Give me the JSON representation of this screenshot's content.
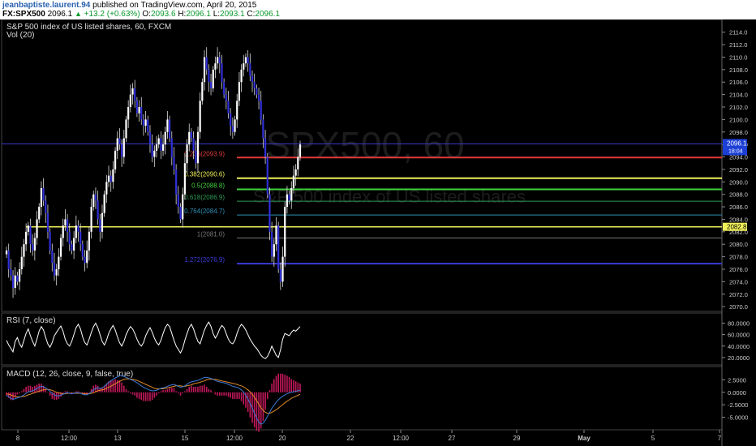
{
  "header": {
    "author": "jeanbaptiste.laurent.94",
    "published": "published on TradingView.com, April 20, 2015",
    "symbol": "FX:SPX500",
    "last": "2096.1",
    "change": "+13.2 (+0.63%)",
    "open_label": "O:",
    "open": "2093.6",
    "high_label": "H:",
    "high": "2096.1",
    "low_label": "L:",
    "low": "2093.1",
    "close_label": "C:",
    "close": "2096.1"
  },
  "legend": {
    "title": "S&P 500 index of US listed shares, 60, FXCM",
    "volume": "Vol (20)",
    "rsi": "RSI (7, close)",
    "macd": "MACD (12, 26, close, 9, false, true)"
  },
  "watermark": {
    "line1": "SPX500, 60",
    "line2": "S&P 500 index of US listed shares"
  },
  "colors": {
    "background": "#000000",
    "candle_up": "#ffffff",
    "candle_down": "#3030d8",
    "fib_0236": "#e23b3b",
    "fib_0382": "#f0f05a",
    "fib_05": "#3fd13f",
    "fib_0618": "#2e9a55",
    "fib_0764": "#2f8fb5",
    "fib_1": "#777777",
    "fib_1272": "#3b3bd6",
    "support_line": "#f0f05a",
    "rsi_line": "#ffffff",
    "macd_line": "#3b7bd8",
    "signal_line": "#e08a2a",
    "hist": "#c2185b"
  },
  "chart_data": [
    {
      "type": "candlestick",
      "title": "S&P 500 index of US listed shares, 60, FXCM",
      "x_ticks": [
        "8",
        "12:00",
        "13",
        "15",
        "12:00",
        "20",
        "22",
        "12:00",
        "27",
        "29",
        "May",
        "5",
        "7"
      ],
      "y_ticks": [
        "2114.0",
        "2112.0",
        "2110.0",
        "2108.0",
        "2106.0",
        "2104.0",
        "2102.0",
        "2100.0",
        "2098.0",
        "2096.0",
        "2094.0",
        "2092.0",
        "2090.0",
        "2088.0",
        "2086.0",
        "2084.0",
        "2082.0",
        "2080.0",
        "2078.0",
        "2076.0",
        "2074.0",
        "2072.0",
        "2070.0"
      ],
      "ylim": [
        2069.5,
        2115.0
      ],
      "close_path": [
        2079,
        2076,
        2075,
        2073,
        2075,
        2074,
        2076,
        2078,
        2080,
        2082,
        2083,
        2080,
        2079,
        2081,
        2084,
        2086,
        2089,
        2087,
        2085,
        2082,
        2079,
        2077,
        2075,
        2076,
        2078,
        2081,
        2083,
        2084,
        2082,
        2080,
        2079,
        2081,
        2083,
        2082,
        2080,
        2078,
        2077,
        2079,
        2082,
        2086,
        2088,
        2087,
        2084,
        2082,
        2085,
        2088,
        2090,
        2091,
        2090,
        2092,
        2095,
        2097,
        2096,
        2094,
        2097,
        2100,
        2102,
        2104,
        2105,
        2103,
        2101,
        2102,
        2100,
        2099,
        2100,
        2098,
        2096,
        2094,
        2095,
        2096,
        2097,
        2095,
        2096,
        2098,
        2100,
        2097,
        2094,
        2092,
        2088,
        2086,
        2084,
        2088,
        2093,
        2096,
        2098,
        2097,
        2095,
        2093,
        2098,
        2103,
        2106,
        2110,
        2108,
        2106,
        2105,
        2108,
        2109,
        2110,
        2109,
        2106,
        2104,
        2103,
        2101,
        2099,
        2098,
        2100,
        2103,
        2106,
        2108,
        2109,
        2110,
        2109,
        2107,
        2106,
        2105,
        2104,
        2103,
        2100,
        2097,
        2094,
        2088,
        2082,
        2078,
        2080,
        2083,
        2076,
        2074,
        2078,
        2086,
        2088,
        2087,
        2089,
        2091,
        2092,
        2094,
        2096
      ],
      "price_label": "2096.1",
      "countdown_label": "18:04",
      "support_label": "2082.8",
      "support_value": 2082.8,
      "fib_levels": [
        {
          "label": "0.236(2093.9)",
          "value": 2093.9,
          "color": "#e23b3b"
        },
        {
          "label": "0.382(2090.6)",
          "value": 2090.6,
          "color": "#f0f05a"
        },
        {
          "label": "0.5(2088.8)",
          "value": 2088.8,
          "color": "#3fd13f"
        },
        {
          "label": "0.618(2086.9)",
          "value": 2086.9,
          "color": "#2e9a55"
        },
        {
          "label": "0.764(2084.7)",
          "value": 2084.7,
          "color": "#2f8fb5"
        },
        {
          "label": "1(2081.0)",
          "value": 2081.0,
          "color": "#777777"
        },
        {
          "label": "1.272(2076.9)",
          "value": 2076.9,
          "color": "#3b3bd6"
        }
      ]
    },
    {
      "type": "line",
      "title": "RSI (7, close)",
      "y_ticks": [
        "80.0000",
        "60.0000",
        "40.0000",
        "20.0000"
      ],
      "ylim": [
        10,
        92
      ],
      "values": [
        50,
        42,
        36,
        30,
        48,
        55,
        44,
        38,
        50,
        62,
        70,
        58,
        48,
        40,
        52,
        66,
        74,
        68,
        55,
        44,
        38,
        46,
        58,
        64,
        70,
        75,
        66,
        52,
        44,
        40,
        48,
        60,
        72,
        78,
        70,
        56,
        46,
        42,
        52,
        64,
        74,
        80,
        72,
        60,
        48,
        42,
        50,
        62,
        70,
        76,
        68,
        56,
        46,
        40,
        48,
        60,
        68,
        74,
        70,
        62,
        52,
        44,
        40,
        46,
        58,
        66,
        72,
        64,
        54,
        46,
        42,
        50,
        62,
        72,
        78,
        74,
        62,
        50,
        40,
        34,
        28,
        36,
        50,
        62,
        72,
        78,
        70,
        58,
        48,
        44,
        56,
        68,
        76,
        82,
        74,
        62,
        54,
        60,
        70,
        76,
        72,
        62,
        52,
        46,
        44,
        50,
        62,
        72,
        78,
        74,
        68,
        60,
        52,
        46,
        40,
        36,
        30,
        24,
        20,
        18,
        22,
        30,
        40,
        32,
        24,
        20,
        34,
        52,
        62,
        60,
        58,
        64,
        68,
        66,
        70,
        74
      ]
    },
    {
      "type": "line",
      "title": "MACD (12, 26, close, 9, false, true)",
      "y_ticks": [
        "2.5000",
        "0.0000",
        "-2.5000",
        "-5.0000"
      ],
      "ylim": [
        -7.2,
        4.2
      ],
      "series": [
        {
          "values": [
            -0.6,
            -0.9,
            -1.2,
            -1.4,
            -1.3,
            -1.1,
            -1.0,
            -0.8,
            -0.5,
            -0.2,
            0.1,
            0.2,
            0.3,
            0.5,
            0.8,
            1.0,
            1.2,
            1.1,
            0.9,
            0.6,
            0.2,
            -0.2,
            -0.5,
            -0.7,
            -0.7,
            -0.6,
            -0.4,
            -0.2,
            -0.1,
            -0.2,
            -0.3,
            -0.2,
            -0.1,
            -0.1,
            -0.2,
            -0.4,
            -0.5,
            -0.5,
            -0.3,
            0.1,
            0.5,
            0.8,
            0.9,
            0.8,
            0.9,
            1.2,
            1.6,
            2.0,
            2.3,
            2.6,
            2.9,
            3.1,
            3.3,
            3.3,
            3.2,
            3.0,
            2.8,
            2.6,
            2.4,
            2.2,
            1.9,
            1.6,
            1.3,
            1.0,
            0.8,
            0.6,
            0.4,
            0.3,
            0.3,
            0.4,
            0.6,
            0.8,
            0.9,
            1.0,
            1.2,
            1.4,
            1.5,
            1.6,
            1.4,
            1.2,
            1.0,
            1.1,
            1.3,
            1.6,
            1.9,
            2.1,
            2.2,
            2.3,
            2.4,
            2.6,
            2.8,
            3.0,
            3.0,
            2.9,
            2.8,
            2.6,
            2.4,
            2.2,
            2.1,
            2.0,
            1.9,
            1.8,
            1.6,
            1.4,
            1.2,
            1.1,
            1.0,
            0.8,
            0.5,
            0.0,
            -0.6,
            -1.3,
            -2.2,
            -3.2,
            -4.2,
            -5.2,
            -6.0,
            -6.4,
            -6.2,
            -5.6,
            -4.8,
            -4.0,
            -3.2,
            -2.6,
            -2.0,
            -1.5,
            -1.1,
            -0.8,
            -0.5,
            -0.3,
            -0.1,
            0.0,
            0.1,
            0.2,
            0.3,
            0.4
          ]
        },
        {
          "values": [
            -0.3,
            -0.4,
            -0.5,
            -0.7,
            -0.8,
            -0.9,
            -0.9,
            -0.9,
            -0.8,
            -0.7,
            -0.5,
            -0.4,
            -0.2,
            -0.1,
            0.1,
            0.2,
            0.4,
            0.5,
            0.6,
            0.6,
            0.5,
            0.4,
            0.2,
            0.0,
            -0.1,
            -0.2,
            -0.3,
            -0.3,
            -0.2,
            -0.2,
            -0.2,
            -0.2,
            -0.2,
            -0.2,
            -0.2,
            -0.2,
            -0.3,
            -0.3,
            -0.3,
            -0.2,
            -0.1,
            0.1,
            0.3,
            0.4,
            0.5,
            0.6,
            0.8,
            1.0,
            1.2,
            1.5,
            1.7,
            2.0,
            2.2,
            2.4,
            2.6,
            2.7,
            2.7,
            2.7,
            2.6,
            2.5,
            2.4,
            2.2,
            2.0,
            1.8,
            1.6,
            1.4,
            1.2,
            1.0,
            0.8,
            0.7,
            0.7,
            0.7,
            0.7,
            0.8,
            0.9,
            1.0,
            1.1,
            1.2,
            1.3,
            1.3,
            1.3,
            1.2,
            1.2,
            1.3,
            1.4,
            1.5,
            1.7,
            1.8,
            1.9,
            2.0,
            2.2,
            2.3,
            2.5,
            2.6,
            2.6,
            2.6,
            2.6,
            2.5,
            2.4,
            2.3,
            2.2,
            2.1,
            2.0,
            1.9,
            1.8,
            1.7,
            1.6,
            1.4,
            1.3,
            1.1,
            0.8,
            0.5,
            0.1,
            -0.4,
            -1.0,
            -1.7,
            -2.4,
            -3.1,
            -3.6,
            -4.0,
            -4.2,
            -4.2,
            -4.0,
            -3.8,
            -3.5,
            -3.2,
            -2.8,
            -2.5,
            -2.1,
            -1.8,
            -1.5,
            -1.2,
            -1.0,
            -0.8,
            -0.6,
            -0.4
          ]
        }
      ]
    }
  ]
}
